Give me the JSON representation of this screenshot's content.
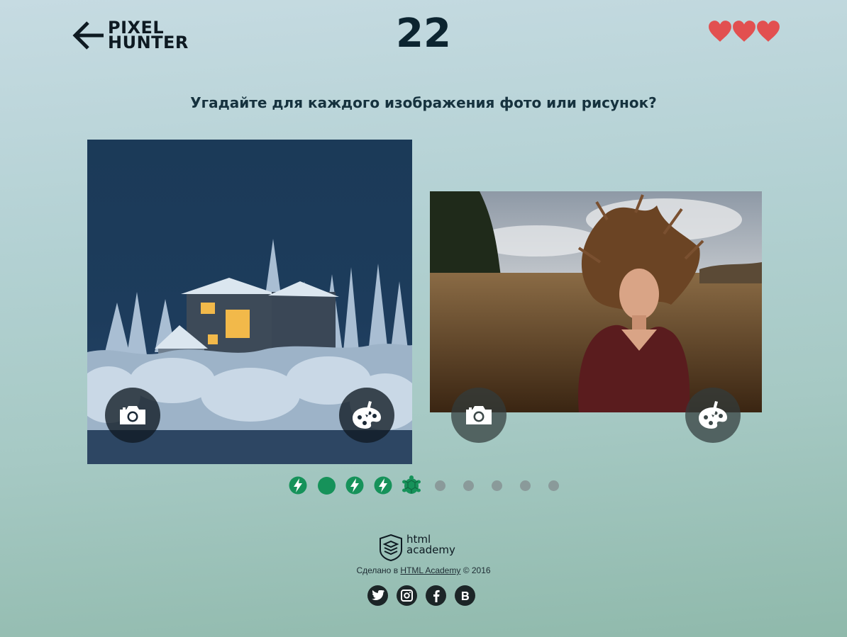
{
  "header": {
    "back_icon": "arrow-left-icon",
    "logo_line1": "PIXEL",
    "logo_line2": "HUNTER",
    "timer": "22",
    "lives": 3,
    "life_icon": "heart-icon",
    "heart_color": "#e25050"
  },
  "question": "Угадайте для каждого изображения фото или рисунок?",
  "options": [
    {
      "image": "snowy house at night in winter forest",
      "photo_icon": "camera-icon",
      "paint_icon": "palette-icon"
    },
    {
      "image": "woman with flying hair in a field",
      "photo_icon": "camera-icon",
      "paint_icon": "palette-icon"
    }
  ],
  "stats": [
    {
      "type": "fast",
      "icon": "lightning-icon"
    },
    {
      "type": "correct",
      "icon": "dot-icon"
    },
    {
      "type": "fast",
      "icon": "lightning-icon"
    },
    {
      "type": "fast",
      "icon": "lightning-icon"
    },
    {
      "type": "slow",
      "icon": "turtle-icon"
    },
    {
      "type": "unknown",
      "icon": "dot-icon"
    },
    {
      "type": "unknown",
      "icon": "dot-icon"
    },
    {
      "type": "unknown",
      "icon": "dot-icon"
    },
    {
      "type": "unknown",
      "icon": "dot-icon"
    },
    {
      "type": "unknown",
      "icon": "dot-icon"
    }
  ],
  "footer": {
    "academy_line1": "html",
    "academy_line2": "academy",
    "made_in": "Сделано в",
    "academy_link": "HTML Academy",
    "year": "© 2016",
    "social": [
      "twitter-icon",
      "instagram-icon",
      "facebook-icon",
      "vk-icon"
    ]
  },
  "colors": {
    "accent_green": "#16925a",
    "dark": "#0c2430"
  }
}
